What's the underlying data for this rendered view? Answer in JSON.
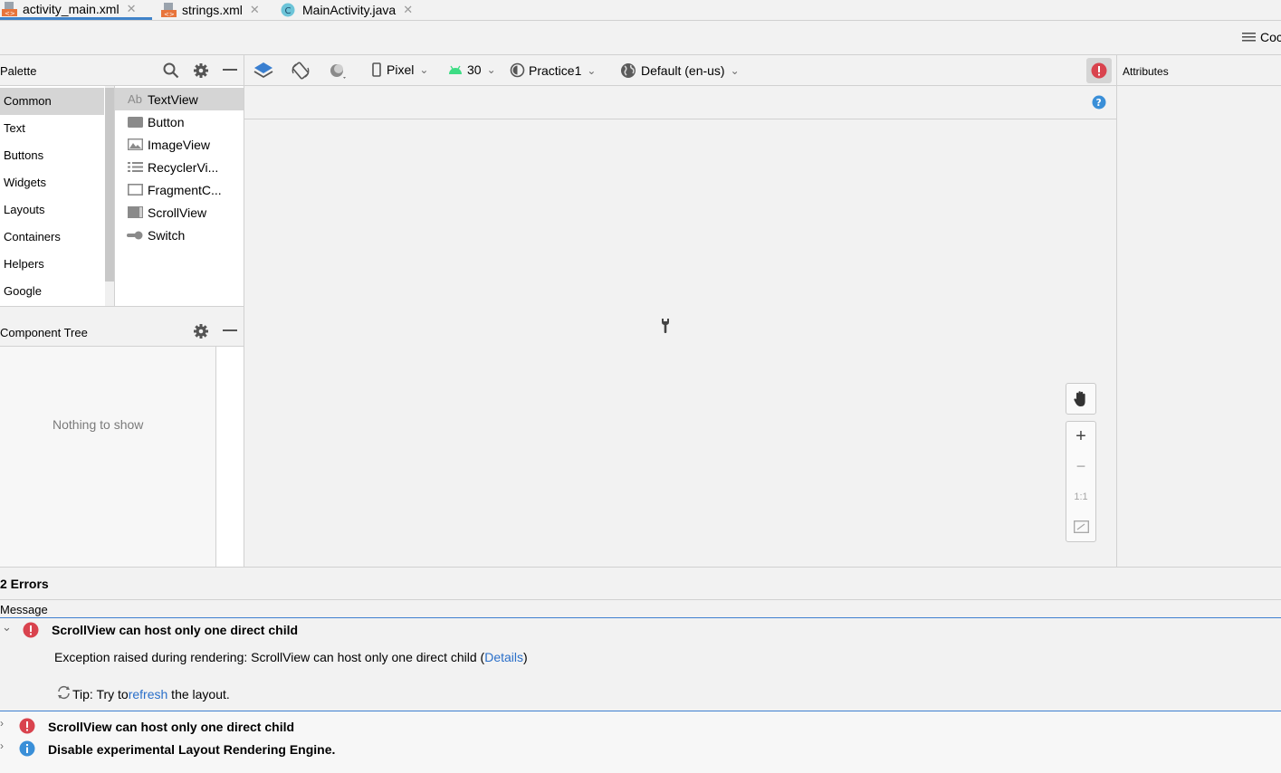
{
  "tabs": [
    {
      "label": "activity_main.xml",
      "active": true
    },
    {
      "label": "strings.xml",
      "active": false
    },
    {
      "label": "MainActivity.java",
      "active": false
    }
  ],
  "view_mode": {
    "code_label": "Coc"
  },
  "palette": {
    "title": "Palette",
    "categories": [
      "Common",
      "Text",
      "Buttons",
      "Widgets",
      "Layouts",
      "Containers",
      "Helpers",
      "Google"
    ],
    "selected_category": "Common",
    "widgets": [
      {
        "label": "TextView",
        "icon": "textview-icon"
      },
      {
        "label": "Button",
        "icon": "button-icon"
      },
      {
        "label": "ImageView",
        "icon": "imageview-icon"
      },
      {
        "label": "RecyclerVi...",
        "icon": "recyclerview-icon"
      },
      {
        "label": "FragmentC...",
        "icon": "fragment-icon"
      },
      {
        "label": "ScrollView",
        "icon": "scrollview-icon"
      },
      {
        "label": "Switch",
        "icon": "switch-icon"
      }
    ],
    "textview_prefix": "Ab"
  },
  "design_toolbar": {
    "device": "Pixel",
    "api": "30",
    "theme": "Practice1",
    "locale": "Default (en-us)"
  },
  "attributes": {
    "title": "Attributes"
  },
  "component_tree": {
    "title": "Component Tree",
    "empty_text": "Nothing to show"
  },
  "zoom": {
    "plus": "+",
    "minus": "−",
    "one_to_one": "1:1"
  },
  "errors_panel": {
    "count_label": "2 Errors",
    "column_header": "Message",
    "items": [
      {
        "title": "ScrollView can host only one direct child",
        "expanded": true,
        "detail_prefix": "Exception raised during rendering: ScrollView can host only one direct child (",
        "detail_link": "Details",
        "detail_suffix": ")",
        "tip_prefix": "Tip: Try to ",
        "tip_link": "refresh",
        "tip_suffix": " the layout."
      },
      {
        "title": "ScrollView can host only one direct child",
        "expanded": false
      },
      {
        "title": "Disable experimental Layout Rendering Engine.",
        "expanded": false
      }
    ]
  },
  "colors": {
    "accent": "#4083c9",
    "error": "#d9434e",
    "info": "#3a8fd8",
    "android_green": "#3ddc84",
    "link": "#2a6fc9"
  }
}
